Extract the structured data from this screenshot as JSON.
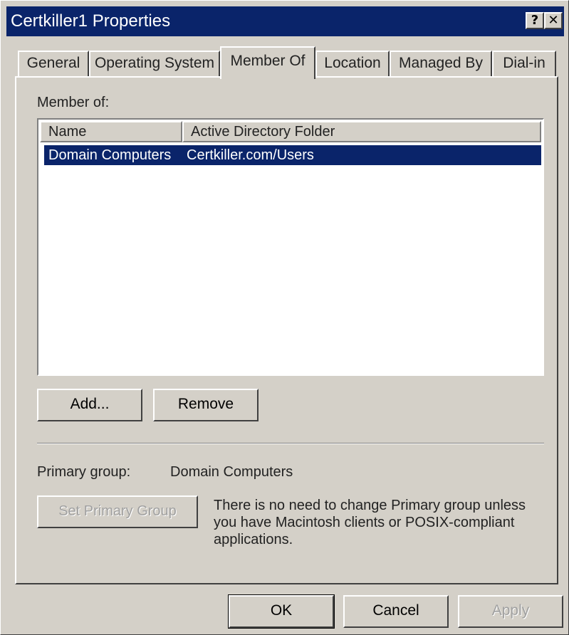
{
  "window": {
    "title": "Certkiller1 Properties",
    "help_label": "?",
    "close_label": "✕"
  },
  "tabs": [
    {
      "label": "General"
    },
    {
      "label": "Operating System"
    },
    {
      "label": "Member Of",
      "active": true
    },
    {
      "label": "Location"
    },
    {
      "label": "Managed By"
    },
    {
      "label": "Dial-in"
    }
  ],
  "member_of": {
    "label": "Member of:",
    "columns": [
      "Name",
      "Active Directory Folder"
    ],
    "rows": [
      {
        "name": "Domain Computers",
        "folder": "Certkiller.com/Users",
        "selected": true
      }
    ]
  },
  "buttons": {
    "add": "Add...",
    "remove": "Remove",
    "set_primary_group": "Set Primary Group",
    "ok": "OK",
    "cancel": "Cancel",
    "apply": "Apply"
  },
  "primary_group": {
    "label": "Primary group:",
    "value": "Domain Computers",
    "note": "There is no need to change Primary group unless you have Macintosh clients or POSIX-compliant applications."
  },
  "colors": {
    "face": "#d4d0c8",
    "titlebar": "#0a246a",
    "selection": "#0a246a"
  }
}
